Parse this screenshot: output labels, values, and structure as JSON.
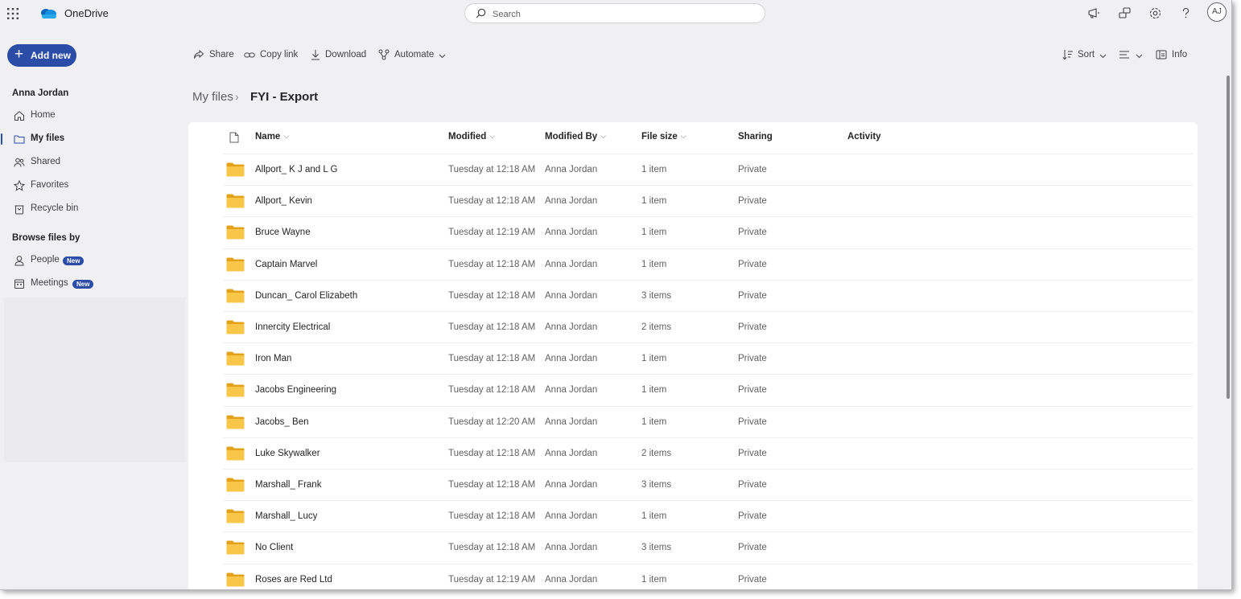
{
  "app": {
    "name": "OneDrive"
  },
  "search": {
    "placeholder": "Search"
  },
  "topbar": {
    "avatar_initials": "AJ"
  },
  "sidebar": {
    "add_new_label": "Add new",
    "user_name": "Anna Jordan",
    "items": [
      {
        "label": "Home",
        "icon": "home-icon"
      },
      {
        "label": "My files",
        "icon": "folder-icon",
        "active": true
      },
      {
        "label": "Shared",
        "icon": "people-icon"
      },
      {
        "label": "Favorites",
        "icon": "star-icon"
      },
      {
        "label": "Recycle bin",
        "icon": "trash-icon"
      }
    ],
    "browse_title": "Browse files by",
    "browse_items": [
      {
        "label": "People",
        "badge": "New",
        "icon": "person-icon"
      },
      {
        "label": "Meetings",
        "badge": "New",
        "icon": "calendar-icon"
      }
    ]
  },
  "toolbar": {
    "share": "Share",
    "copy_link": "Copy link",
    "download": "Download",
    "automate": "Automate",
    "sort": "Sort",
    "info": "Info"
  },
  "breadcrumb": {
    "root": "My files",
    "current": "FYI - Export"
  },
  "table": {
    "headers": {
      "name": "Name",
      "modified": "Modified",
      "modified_by": "Modified By",
      "file_size": "File size",
      "sharing": "Sharing",
      "activity": "Activity"
    },
    "rows": [
      {
        "name": "Allport_ K J and L G",
        "modified": "Tuesday at 12:18 AM",
        "modified_by": "Anna Jordan",
        "size": "1 item",
        "sharing": "Private"
      },
      {
        "name": "Allport_ Kevin",
        "modified": "Tuesday at 12:18 AM",
        "modified_by": "Anna Jordan",
        "size": "1 item",
        "sharing": "Private"
      },
      {
        "name": "Bruce Wayne",
        "modified": "Tuesday at 12:19 AM",
        "modified_by": "Anna Jordan",
        "size": "1 item",
        "sharing": "Private"
      },
      {
        "name": "Captain Marvel",
        "modified": "Tuesday at 12:18 AM",
        "modified_by": "Anna Jordan",
        "size": "1 item",
        "sharing": "Private"
      },
      {
        "name": "Duncan_ Carol Elizabeth",
        "modified": "Tuesday at 12:18 AM",
        "modified_by": "Anna Jordan",
        "size": "3 items",
        "sharing": "Private"
      },
      {
        "name": "Innercity Electrical",
        "modified": "Tuesday at 12:18 AM",
        "modified_by": "Anna Jordan",
        "size": "2 items",
        "sharing": "Private"
      },
      {
        "name": "Iron Man",
        "modified": "Tuesday at 12:18 AM",
        "modified_by": "Anna Jordan",
        "size": "1 item",
        "sharing": "Private"
      },
      {
        "name": "Jacobs Engineering",
        "modified": "Tuesday at 12:18 AM",
        "modified_by": "Anna Jordan",
        "size": "1 item",
        "sharing": "Private"
      },
      {
        "name": "Jacobs_ Ben",
        "modified": "Tuesday at 12:20 AM",
        "modified_by": "Anna Jordan",
        "size": "1 item",
        "sharing": "Private"
      },
      {
        "name": "Luke Skywalker",
        "modified": "Tuesday at 12:18 AM",
        "modified_by": "Anna Jordan",
        "size": "2 items",
        "sharing": "Private"
      },
      {
        "name": "Marshall_ Frank",
        "modified": "Tuesday at 12:18 AM",
        "modified_by": "Anna Jordan",
        "size": "3 items",
        "sharing": "Private"
      },
      {
        "name": "Marshall_ Lucy",
        "modified": "Tuesday at 12:18 AM",
        "modified_by": "Anna Jordan",
        "size": "1 item",
        "sharing": "Private"
      },
      {
        "name": "No Client",
        "modified": "Tuesday at 12:18 AM",
        "modified_by": "Anna Jordan",
        "size": "3 items",
        "sharing": "Private"
      },
      {
        "name": "Roses are Red Ltd",
        "modified": "Tuesday at 12:19 AM",
        "modified_by": "Anna Jordan",
        "size": "1 item",
        "sharing": "Private"
      }
    ]
  },
  "colors": {
    "accent": "#2b4da8",
    "folder": "#f8c74a",
    "background": "#f0f0f3"
  }
}
